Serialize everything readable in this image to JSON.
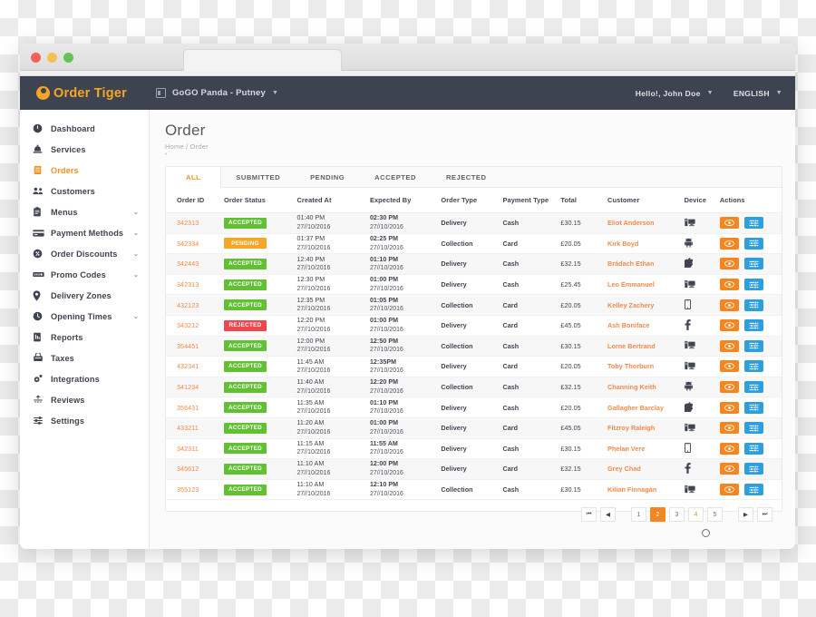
{
  "browser": {
    "traffic_lights": [
      "close",
      "minimize",
      "maximize"
    ]
  },
  "topbar": {
    "logo_first": "Order",
    "logo_second": "Tiger",
    "store_name": "GoGO Panda -  Putney",
    "store_caret": "▼",
    "greeting": "Hello!, John Doe",
    "greeting_caret": "▼",
    "language": "ENGLISH",
    "language_caret": "▼"
  },
  "sidebar": {
    "items": [
      {
        "label": "Dashboard",
        "icon": "dashboard-icon",
        "chevron": "",
        "active": false
      },
      {
        "label": "Services",
        "icon": "services-icon",
        "chevron": "",
        "active": false
      },
      {
        "label": "Orders",
        "icon": "orders-icon",
        "chevron": "",
        "active": true
      },
      {
        "label": "Customers",
        "icon": "customers-icon",
        "chevron": "",
        "active": false
      },
      {
        "label": "Menus",
        "icon": "menus-icon",
        "chevron": "⌄",
        "active": false
      },
      {
        "label": "Payment Methods",
        "icon": "payment-methods-icon",
        "chevron": "⌄",
        "active": false
      },
      {
        "label": "Order Discounts",
        "icon": "order-discounts-icon",
        "chevron": "⌄",
        "active": false
      },
      {
        "label": "Promo Codes",
        "icon": "promo-codes-icon",
        "chevron": "⌄",
        "active": false
      },
      {
        "label": "Delivery Zones",
        "icon": "delivery-zones-icon",
        "chevron": "",
        "active": false
      },
      {
        "label": "Opening Times",
        "icon": "opening-times-icon",
        "chevron": "⌄",
        "active": false
      },
      {
        "label": "Reports",
        "icon": "reports-icon",
        "chevron": "",
        "active": false
      },
      {
        "label": "Taxes",
        "icon": "taxes-icon",
        "chevron": "",
        "active": false
      },
      {
        "label": "Integrations",
        "icon": "integrations-icon",
        "chevron": "",
        "active": false
      },
      {
        "label": "Reviews",
        "icon": "reviews-icon",
        "chevron": "",
        "active": false
      },
      {
        "label": "Settings",
        "icon": "settings-icon",
        "chevron": "",
        "active": false
      }
    ]
  },
  "page": {
    "title": "Order",
    "breadcrumb": "Home / Order",
    "breadcrumb_dot": "•"
  },
  "tabs": [
    {
      "label": "ALL",
      "active": true
    },
    {
      "label": "SUBMITTED",
      "active": false
    },
    {
      "label": "PENDING",
      "active": false
    },
    {
      "label": "ACCEPTED",
      "active": false
    },
    {
      "label": "REJECTED",
      "active": false
    }
  ],
  "table": {
    "columns": [
      "Order ID",
      "Order Status",
      "Created At",
      "Expected By",
      "Order Type",
      "Payment Type",
      "Total",
      "Customer",
      "Device",
      "Actions"
    ],
    "rows": [
      {
        "id": "342313",
        "status": "ACCEPTED",
        "status_kind": "accepted",
        "created_time": "01:40 PM",
        "created_date": "27//10/2016",
        "expected_time": "02:30 PM",
        "expected_date": "27//10/2016",
        "type": "Delivery",
        "payment": "Cash",
        "total": "£30.15",
        "customer": "Eliot Anderson",
        "device": "desktop-icon"
      },
      {
        "id": "342334",
        "status": "PENDING",
        "status_kind": "pending",
        "created_time": "01:37 PM",
        "created_date": "27//10/2016",
        "expected_time": "02:25 PM",
        "expected_date": "27//10/2016",
        "type": "Collection",
        "payment": "Card",
        "total": "£20.05",
        "customer": "Kirk Boyd",
        "device": "android-icon"
      },
      {
        "id": "342443",
        "status": "ACCEPTED",
        "status_kind": "accepted",
        "created_time": "12:40 PM",
        "created_date": "27//10/2016",
        "expected_time": "01:10 PM",
        "expected_date": "27//10/2016",
        "type": "Delivery",
        "payment": "Cash",
        "total": "£32.15",
        "customer": "Brádach Ethan",
        "device": "apple-icon"
      },
      {
        "id": "342313",
        "status": "ACCEPTED",
        "status_kind": "accepted",
        "created_time": "12:30 PM",
        "created_date": "27//10/2016",
        "expected_time": "01:00 PM",
        "expected_date": "27//10/2016",
        "type": "Delivery",
        "payment": "Cash",
        "total": "£25.45",
        "customer": "Leo Emmanuel",
        "device": "desktop-icon"
      },
      {
        "id": "432123",
        "status": "ACCEPTED",
        "status_kind": "accepted",
        "created_time": "12:35 PM",
        "created_date": "27//10/2016",
        "expected_time": "01:05 PM",
        "expected_date": "27//10/2016",
        "type": "Collection",
        "payment": "Card",
        "total": "£20.05",
        "customer": "Kelley Zachery",
        "device": "mobile-icon"
      },
      {
        "id": "343212",
        "status": "REJECTED",
        "status_kind": "rejected",
        "created_time": "12:20 PM",
        "created_date": "27//10/2016",
        "expected_time": "01:00 PM",
        "expected_date": "27//10/2016",
        "type": "Delivery",
        "payment": "Card",
        "total": "£45.05",
        "customer": "Ash Boniface",
        "device": "facebook-icon"
      },
      {
        "id": "354451",
        "status": "ACCEPTED",
        "status_kind": "accepted",
        "created_time": "12:00 PM",
        "created_date": "27//10/2016",
        "expected_time": "12:50 PM",
        "expected_date": "27//10/2016",
        "type": "Collection",
        "payment": "Cash",
        "total": "£30.15",
        "customer": "Lorne Bertrand",
        "device": "desktop-icon"
      },
      {
        "id": "432341",
        "status": "ACCEPTED",
        "status_kind": "accepted",
        "created_time": "11:45 AM",
        "created_date": "27//10/2016",
        "expected_time": "12:35PM",
        "expected_date": "27//10/2016",
        "type": "Delivery",
        "payment": "Card",
        "total": "£20.05",
        "customer": "Toby Thorburn",
        "device": "desktop-icon"
      },
      {
        "id": "341234",
        "status": "ACCEPTED",
        "status_kind": "accepted",
        "created_time": "11:40 AM",
        "created_date": "27//10/2016",
        "expected_time": "12:20 PM",
        "expected_date": "27//10/2016",
        "type": "Collection",
        "payment": "Cash",
        "total": "£32.15",
        "customer": "Channing Keith",
        "device": "android-icon"
      },
      {
        "id": "356431",
        "status": "ACCEPTED",
        "status_kind": "accepted",
        "created_time": "11:35 AM",
        "created_date": "27//10/2016",
        "expected_time": "01:10 PM",
        "expected_date": "27//10/2016",
        "type": "Delivery",
        "payment": "Cash",
        "total": "£20.05",
        "customer": "Gallagher Barclay",
        "device": "apple-icon"
      },
      {
        "id": "433211",
        "status": "ACCEPTED",
        "status_kind": "accepted",
        "created_time": "11:20 AM",
        "created_date": "27//10/2016",
        "expected_time": "01:00 PM",
        "expected_date": "27//10/2016",
        "type": "Delivery",
        "payment": "Card",
        "total": "£45.05",
        "customer": "Fitzroy Raleigh",
        "device": "desktop-icon"
      },
      {
        "id": "342311",
        "status": "ACCEPTED",
        "status_kind": "accepted",
        "created_time": "11:15 AM",
        "created_date": "27//10/2016",
        "expected_time": "11:55 AM",
        "expected_date": "27//10/2016",
        "type": "Delivery",
        "payment": "Cash",
        "total": "£30.15",
        "customer": "Phelan Vere",
        "device": "mobile-icon"
      },
      {
        "id": "345612",
        "status": "ACCEPTED",
        "status_kind": "accepted",
        "created_time": "11:10 AM",
        "created_date": "27//10/2016",
        "expected_time": "12:00 PM",
        "expected_date": "27//10/2016",
        "type": "Delivery",
        "payment": "Card",
        "total": "£32.15",
        "customer": "Grey Chad",
        "device": "facebook-icon"
      },
      {
        "id": "355123",
        "status": "ACCEPTED",
        "status_kind": "accepted",
        "created_time": "11:10 AM",
        "created_date": "27//10/2016",
        "expected_time": "12:10 PM",
        "expected_date": "27//10/2016",
        "type": "Collection",
        "payment": "Cash",
        "total": "£30.15",
        "customer": "Kilian Finnagán",
        "device": "desktop-icon"
      }
    ],
    "action_buttons": [
      {
        "name": "view-order-button",
        "icon": "eye-icon"
      },
      {
        "name": "order-details-button",
        "icon": "sliders-icon"
      }
    ]
  },
  "pagination": {
    "first": "⏮",
    "prev": "◀",
    "pages": [
      {
        "label": "1",
        "active": false,
        "hover": false
      },
      {
        "label": "2",
        "active": true,
        "hover": false
      },
      {
        "label": "3",
        "active": false,
        "hover": false
      },
      {
        "label": "4",
        "active": false,
        "hover": true
      },
      {
        "label": "5",
        "active": false,
        "hover": false
      }
    ],
    "next": "▶",
    "last": "⏭"
  },
  "colors": {
    "accent_orange": "#f5901f",
    "topbar_dark": "#3d4350",
    "status_accepted": "#62c033",
    "status_pending": "#f5a623",
    "status_rejected": "#f0474f",
    "action_view": "#f5861f",
    "action_list": "#2d9fe0"
  }
}
